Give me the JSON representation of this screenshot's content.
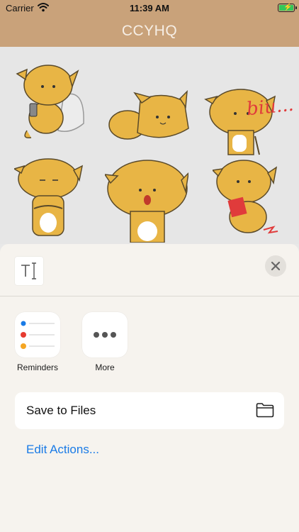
{
  "status_bar": {
    "carrier": "Carrier",
    "time": "11:39 AM",
    "wifi_icon": "wifi-icon",
    "battery_icon": "battery-charging-icon",
    "battery_level": 1.0
  },
  "nav": {
    "title": "CCYHQ"
  },
  "stickers": {
    "caption": "biu...",
    "accent_colors": {
      "fur": "#e8b545",
      "belly": "#ffffff",
      "red": "#e03b3b"
    },
    "items": [
      {
        "name": "cat-sitting-with-phone-sticker"
      },
      {
        "name": "cat-lying-down-sticker"
      },
      {
        "name": "cat-pointing-biu-sticker"
      },
      {
        "name": "cat-arms-crossed-sticker"
      },
      {
        "name": "cat-surprised-sticker"
      },
      {
        "name": "cat-holding-red-envelope-sticker"
      }
    ]
  },
  "share_sheet": {
    "preview_icon": "text-cursor-icon",
    "close_icon": "close-icon",
    "apps": [
      {
        "label": "Reminders",
        "icon": "reminders-icon"
      },
      {
        "label": "More",
        "icon": "more-icon"
      }
    ],
    "actions": [
      {
        "label": "Save to Files",
        "icon": "folder-icon"
      }
    ],
    "edit_actions_label": "Edit Actions..."
  },
  "colors": {
    "nav_background": "#c9a27a",
    "nav_title": "#f6eee5",
    "sheet_background": "#f6f3ee",
    "link_blue": "#1a7be6",
    "battery_green": "#34c759"
  }
}
